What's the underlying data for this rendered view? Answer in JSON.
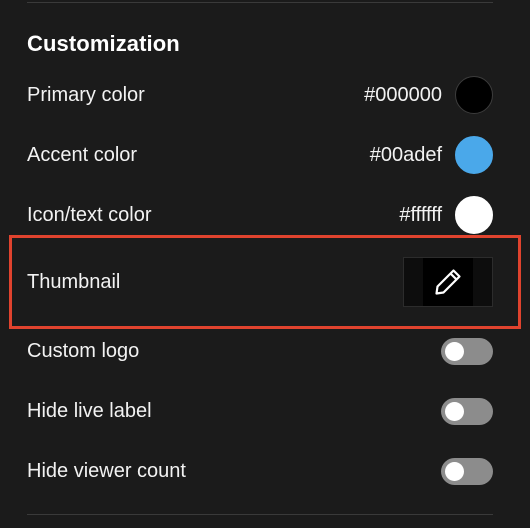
{
  "section": {
    "title": "Customization"
  },
  "colors": {
    "primary": {
      "label": "Primary color",
      "value": "#000000"
    },
    "accent": {
      "label": "Accent color",
      "value": "#00adef"
    },
    "icon_text": {
      "label": "Icon/text color",
      "value": "#ffffff"
    }
  },
  "thumbnail": {
    "label": "Thumbnail",
    "edit_icon": "pencil-icon"
  },
  "toggles": {
    "custom_logo": {
      "label": "Custom logo",
      "on": false
    },
    "hide_live_label": {
      "label": "Hide live label",
      "on": false
    },
    "hide_viewer_count": {
      "label": "Hide viewer count",
      "on": false
    }
  },
  "theme": {
    "background": "#1b1b1b",
    "highlight": "#e0432e",
    "swatch_primary": "#000000",
    "swatch_accent": "#4aa8ea",
    "swatch_icon_text": "#ffffff",
    "toggle_off": "#8c8c8c"
  }
}
